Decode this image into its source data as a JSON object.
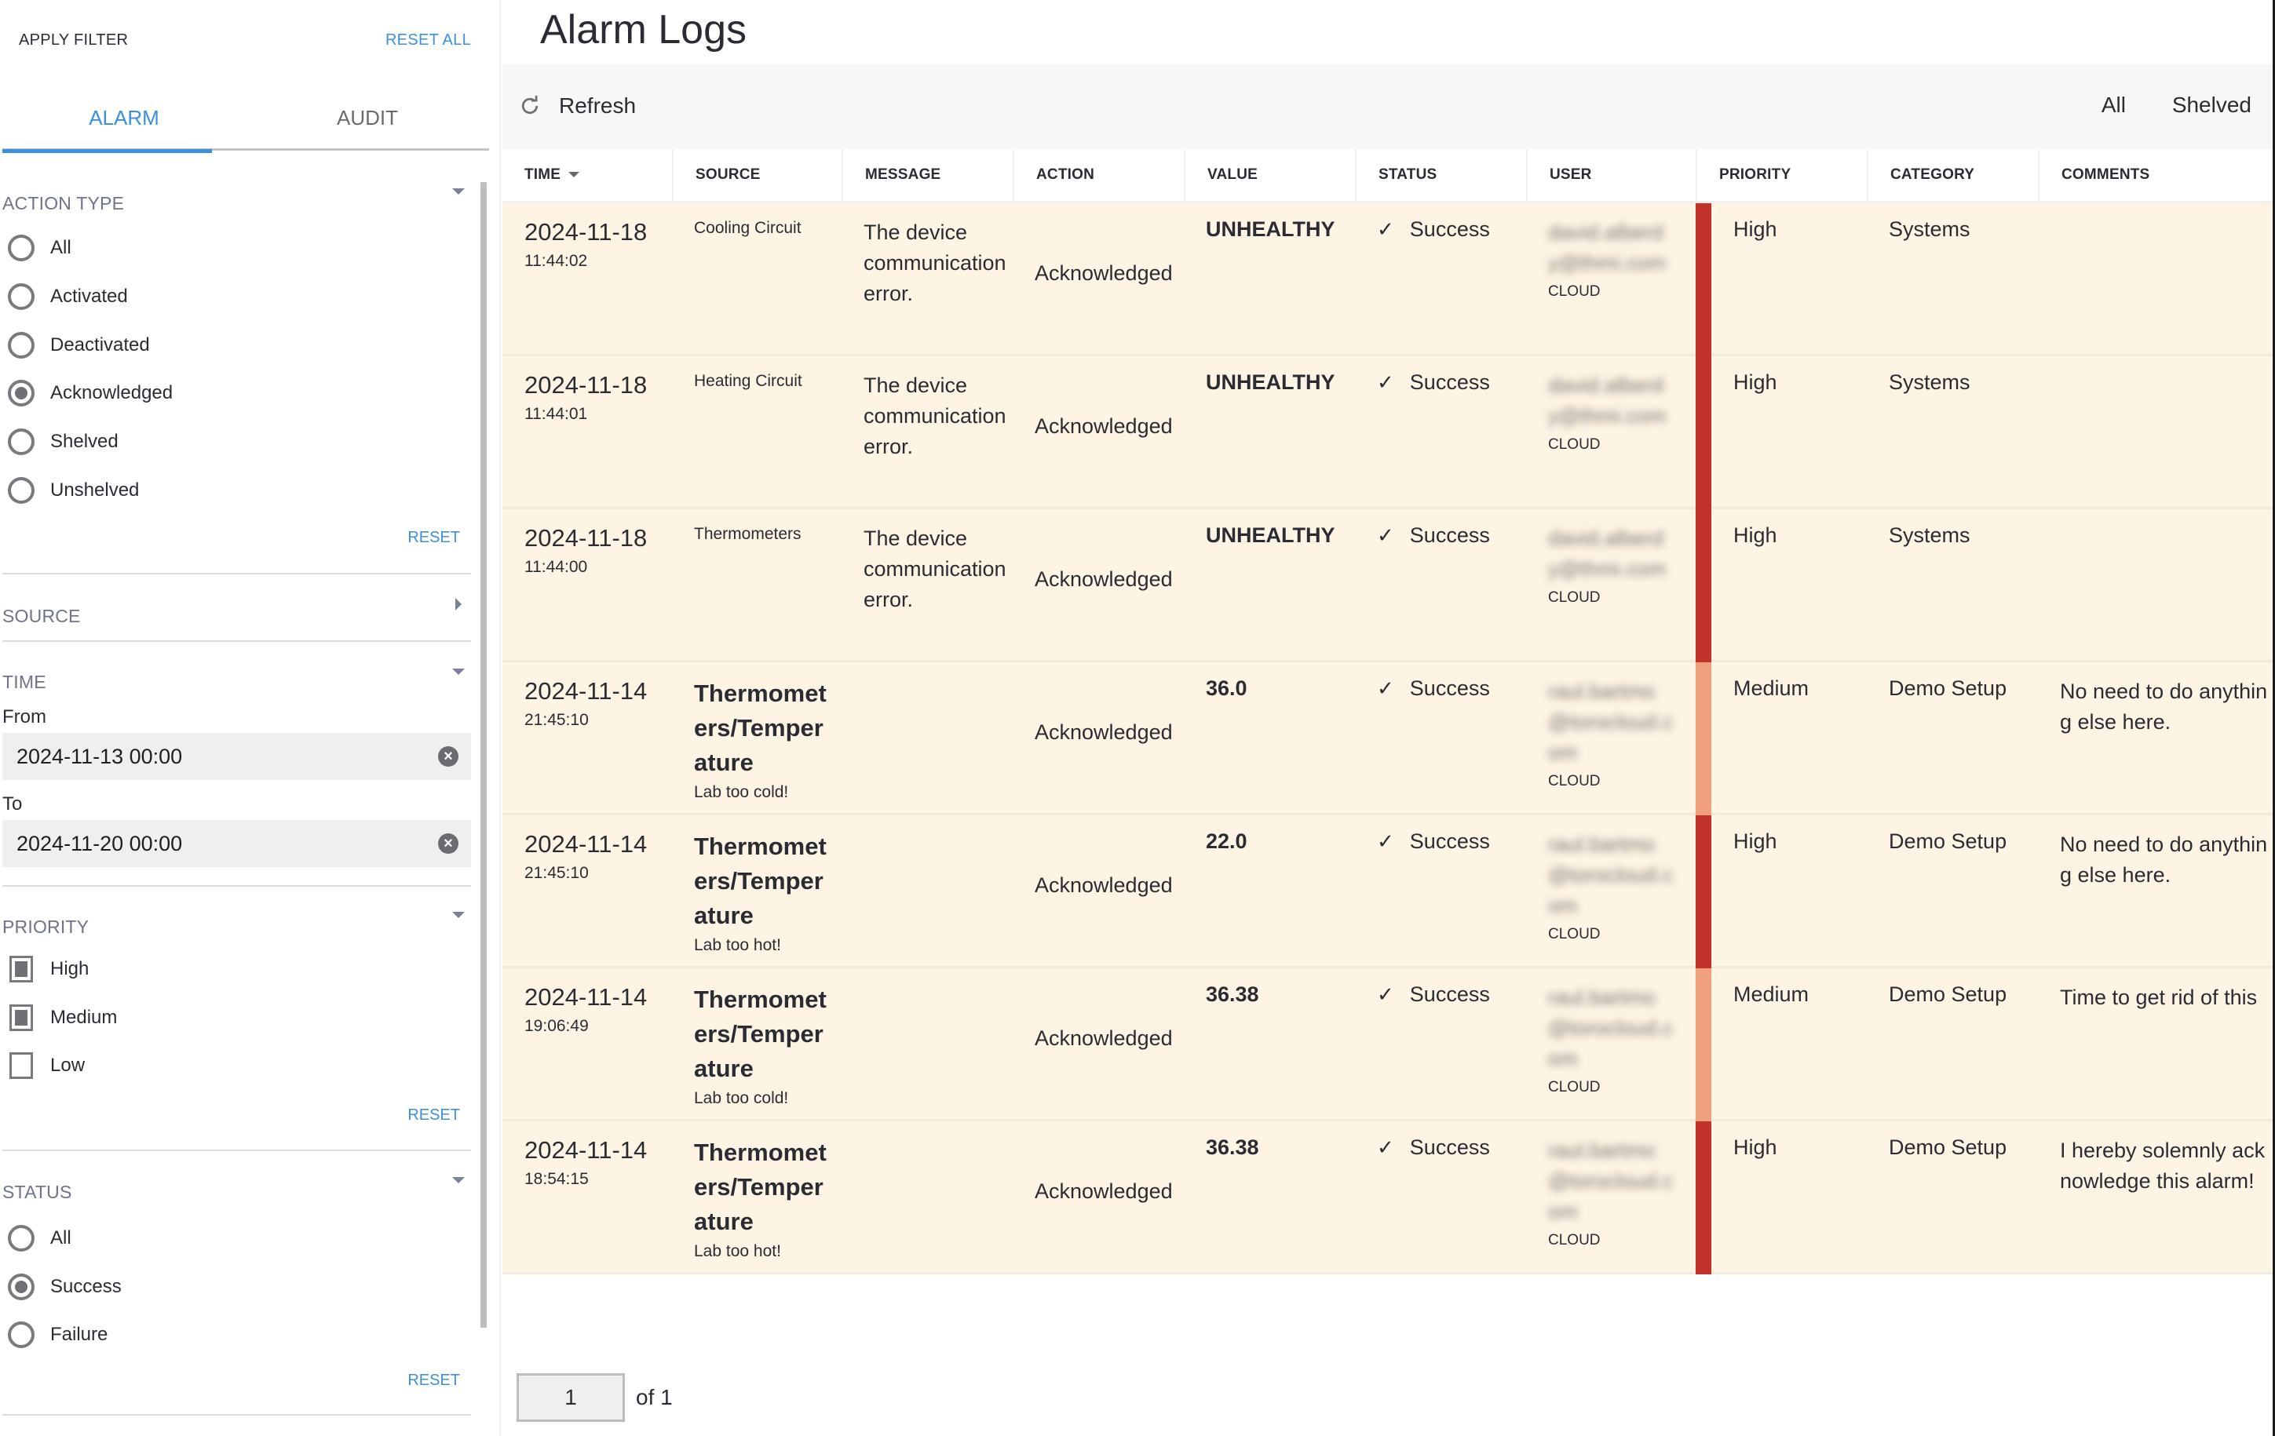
{
  "sidebar": {
    "apply_filter": "APPLY FILTER",
    "reset_all": "RESET ALL",
    "tabs": [
      {
        "label": "ALARM",
        "active": true
      },
      {
        "label": "AUDIT",
        "active": false
      }
    ],
    "action_type": {
      "title": "ACTION TYPE",
      "options": [
        {
          "label": "All",
          "checked": false
        },
        {
          "label": "Activated",
          "checked": false
        },
        {
          "label": "Deactivated",
          "checked": false
        },
        {
          "label": "Acknowledged",
          "checked": true
        },
        {
          "label": "Shelved",
          "checked": false
        },
        {
          "label": "Unshelved",
          "checked": false
        }
      ],
      "reset": "RESET"
    },
    "source": {
      "title": "SOURCE"
    },
    "time": {
      "title": "TIME",
      "from_label": "From",
      "from_value": "2024-11-13 00:00",
      "to_label": "To",
      "to_value": "2024-11-20 00:00"
    },
    "priority": {
      "title": "PRIORITY",
      "options": [
        {
          "label": "High",
          "checked": true
        },
        {
          "label": "Medium",
          "checked": true
        },
        {
          "label": "Low",
          "checked": false
        }
      ],
      "reset": "RESET"
    },
    "status": {
      "title": "STATUS",
      "options": [
        {
          "label": "All",
          "checked": false
        },
        {
          "label": "Success",
          "checked": true
        },
        {
          "label": "Failure",
          "checked": false
        }
      ],
      "reset": "RESET"
    }
  },
  "main": {
    "title": "Alarm Logs",
    "refresh_label": "Refresh",
    "view_all": "All",
    "view_shelved": "Shelved",
    "columns": [
      "TIME",
      "SOURCE",
      "MESSAGE",
      "ACTION",
      "VALUE",
      "STATUS",
      "USER",
      "PRIORITY",
      "CATEGORY",
      "COMMENTS"
    ],
    "priority_colors": {
      "High": "#c0322a",
      "Medium": "#f0a07c"
    },
    "rows": [
      {
        "date": "2024-11-18",
        "time": "11:44:02",
        "source": "Cooling Circuit",
        "source_style": "small",
        "source_sub": "",
        "message": "The device communication error.",
        "action": "Acknowledged",
        "value": "UNHEALTHY",
        "status": "Success",
        "user": "david.alberdy@thmi.com",
        "user_source": "CLOUD",
        "priority": "High",
        "category": "Systems",
        "comment": ""
      },
      {
        "date": "2024-11-18",
        "time": "11:44:01",
        "source": "Heating Circuit",
        "source_style": "small",
        "source_sub": "",
        "message": "The device communication error.",
        "action": "Acknowledged",
        "value": "UNHEALTHY",
        "status": "Success",
        "user": "david.alberdy@thmi.com",
        "user_source": "CLOUD",
        "priority": "High",
        "category": "Systems",
        "comment": ""
      },
      {
        "date": "2024-11-18",
        "time": "11:44:00",
        "source": "Thermometers",
        "source_style": "small",
        "source_sub": "",
        "message": "The device communication error.",
        "action": "Acknowledged",
        "value": "UNHEALTHY",
        "status": "Success",
        "user": "david.alberdy@thmi.com",
        "user_source": "CLOUD",
        "priority": "High",
        "category": "Systems",
        "comment": ""
      },
      {
        "date": "2024-11-14",
        "time": "21:45:10",
        "source": "Thermometers/Temperature",
        "source_style": "bold",
        "source_sub": "Lab too cold!",
        "message": "",
        "action": "Acknowledged",
        "value": "36.0",
        "status": "Success",
        "user": "raul.bartmo@torocloud.com",
        "user_source": "CLOUD",
        "priority": "Medium",
        "category": "Demo Setup",
        "comment": "No need to do anything else here."
      },
      {
        "date": "2024-11-14",
        "time": "21:45:10",
        "source": "Thermometers/Temperature",
        "source_style": "bold",
        "source_sub": "Lab too hot!",
        "message": "",
        "action": "Acknowledged",
        "value": "22.0",
        "status": "Success",
        "user": "raul.bartmo@torocloud.com",
        "user_source": "CLOUD",
        "priority": "High",
        "category": "Demo Setup",
        "comment": "No need to do anything else here."
      },
      {
        "date": "2024-11-14",
        "time": "19:06:49",
        "source": "Thermometers/Temperature",
        "source_style": "bold",
        "source_sub": "Lab too cold!",
        "message": "",
        "action": "Acknowledged",
        "value": "36.38",
        "status": "Success",
        "user": "raul.bartmo@torocloud.com",
        "user_source": "CLOUD",
        "priority": "Medium",
        "category": "Demo Setup",
        "comment": "Time to get rid of this"
      },
      {
        "date": "2024-11-14",
        "time": "18:54:15",
        "source": "Thermometers/Temperature",
        "source_style": "bold",
        "source_sub": "Lab too hot!",
        "message": "",
        "action": "Acknowledged",
        "value": "36.38",
        "status": "Success",
        "user": "raul.bartmo@torocloud.com",
        "user_source": "CLOUD",
        "priority": "High",
        "category": "Demo Setup",
        "comment": "I hereby solemnly acknowledge this alarm!"
      }
    ],
    "pager": {
      "current": "1",
      "of_label": "of 1"
    }
  }
}
